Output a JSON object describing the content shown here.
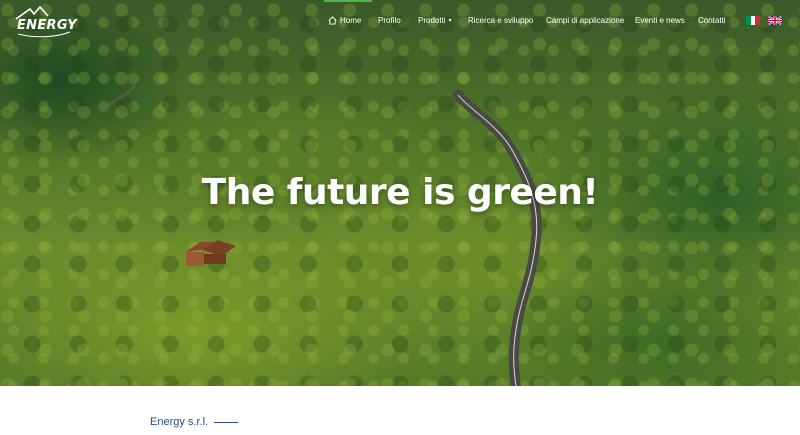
{
  "brand": {
    "logo_text": "ENERGY"
  },
  "nav": {
    "items": [
      {
        "label": "Home",
        "active": true
      },
      {
        "label": "Profilo"
      },
      {
        "label": "Prodotti",
        "dropdown": true
      },
      {
        "label": "Ricerca e sviluppo"
      },
      {
        "label": "Campi di applicazione"
      },
      {
        "label": "Eventi e news"
      },
      {
        "label": "Contatti"
      }
    ],
    "active_color": "#4cb848"
  },
  "languages": [
    {
      "code": "it",
      "icon": "italy-flag-icon"
    },
    {
      "code": "en",
      "icon": "uk-flag-icon"
    }
  ],
  "hero": {
    "title": "The future is green!"
  },
  "intro": {
    "company": "Energy s.r.l."
  }
}
